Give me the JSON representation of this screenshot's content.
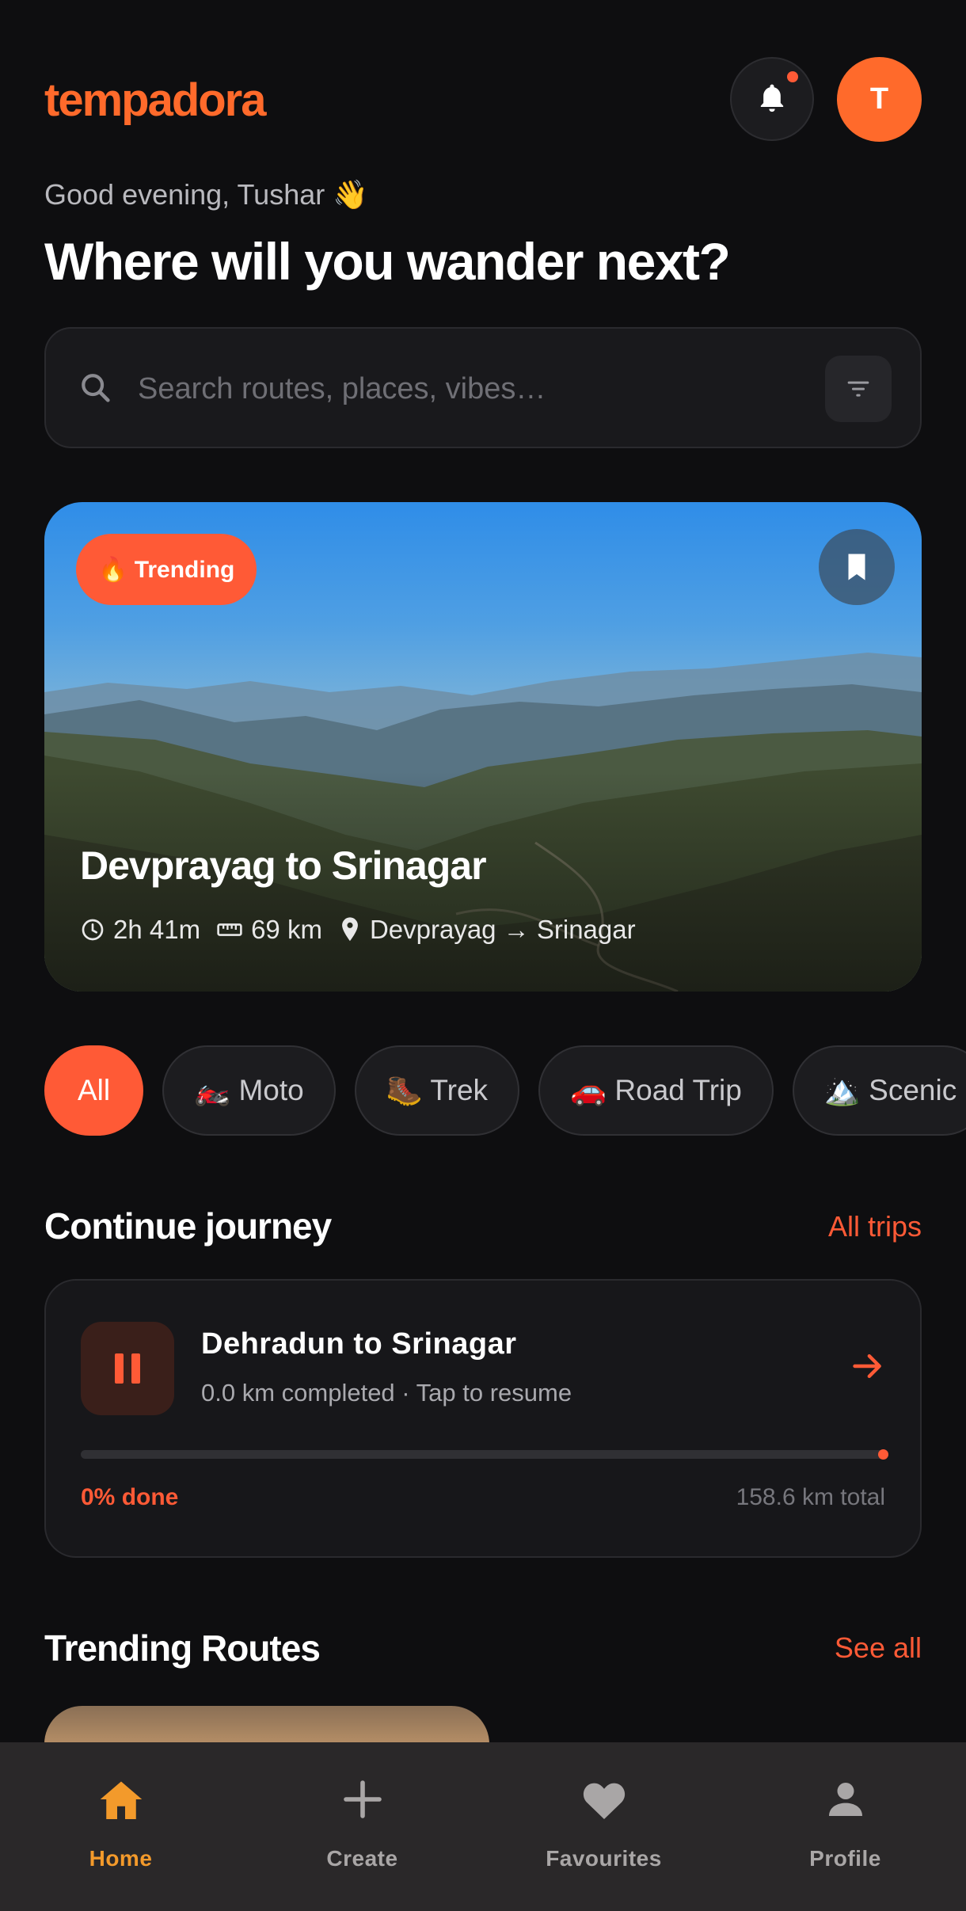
{
  "app": {
    "logo": "tempadora"
  },
  "header": {
    "avatar_initial": "T",
    "has_notification": true
  },
  "greeting": "Good evening, Tushar 👋",
  "headline": "Where will you wander next?",
  "search": {
    "placeholder": "Search routes, places, vibes…"
  },
  "hero": {
    "badge": "🔥 Trending",
    "title": "Devprayag to Srinagar",
    "duration": "2h 41m",
    "distance": "69 km",
    "route": "Devprayag → Srinagar"
  },
  "chips": [
    {
      "label": "All",
      "active": true
    },
    {
      "label": "🏍️ Moto"
    },
    {
      "label": "🥾 Trek"
    },
    {
      "label": "🚗 Road Trip"
    },
    {
      "label": "🏔️ Scenic"
    }
  ],
  "continue": {
    "section_title": "Continue journey",
    "link": "All trips",
    "trip_title": "Dehradun to Srinagar",
    "subtitle": "0.0 km completed · Tap to resume",
    "progress_fraction": 0,
    "progress_label": "0% done",
    "total_label": "158.6 km total"
  },
  "trending": {
    "section_title": "Trending Routes",
    "link": "See all"
  },
  "nav": [
    {
      "label": "Home",
      "icon": "home-icon",
      "active": true
    },
    {
      "label": "Create",
      "icon": "plus-icon"
    },
    {
      "label": "Favourites",
      "icon": "heart-icon"
    },
    {
      "label": "Profile",
      "icon": "person-icon"
    }
  ],
  "colors": {
    "accent": "#ff5a36",
    "logo": "#ff6a2b",
    "nav_active": "#f39a2b",
    "background": "#0e0e10"
  }
}
